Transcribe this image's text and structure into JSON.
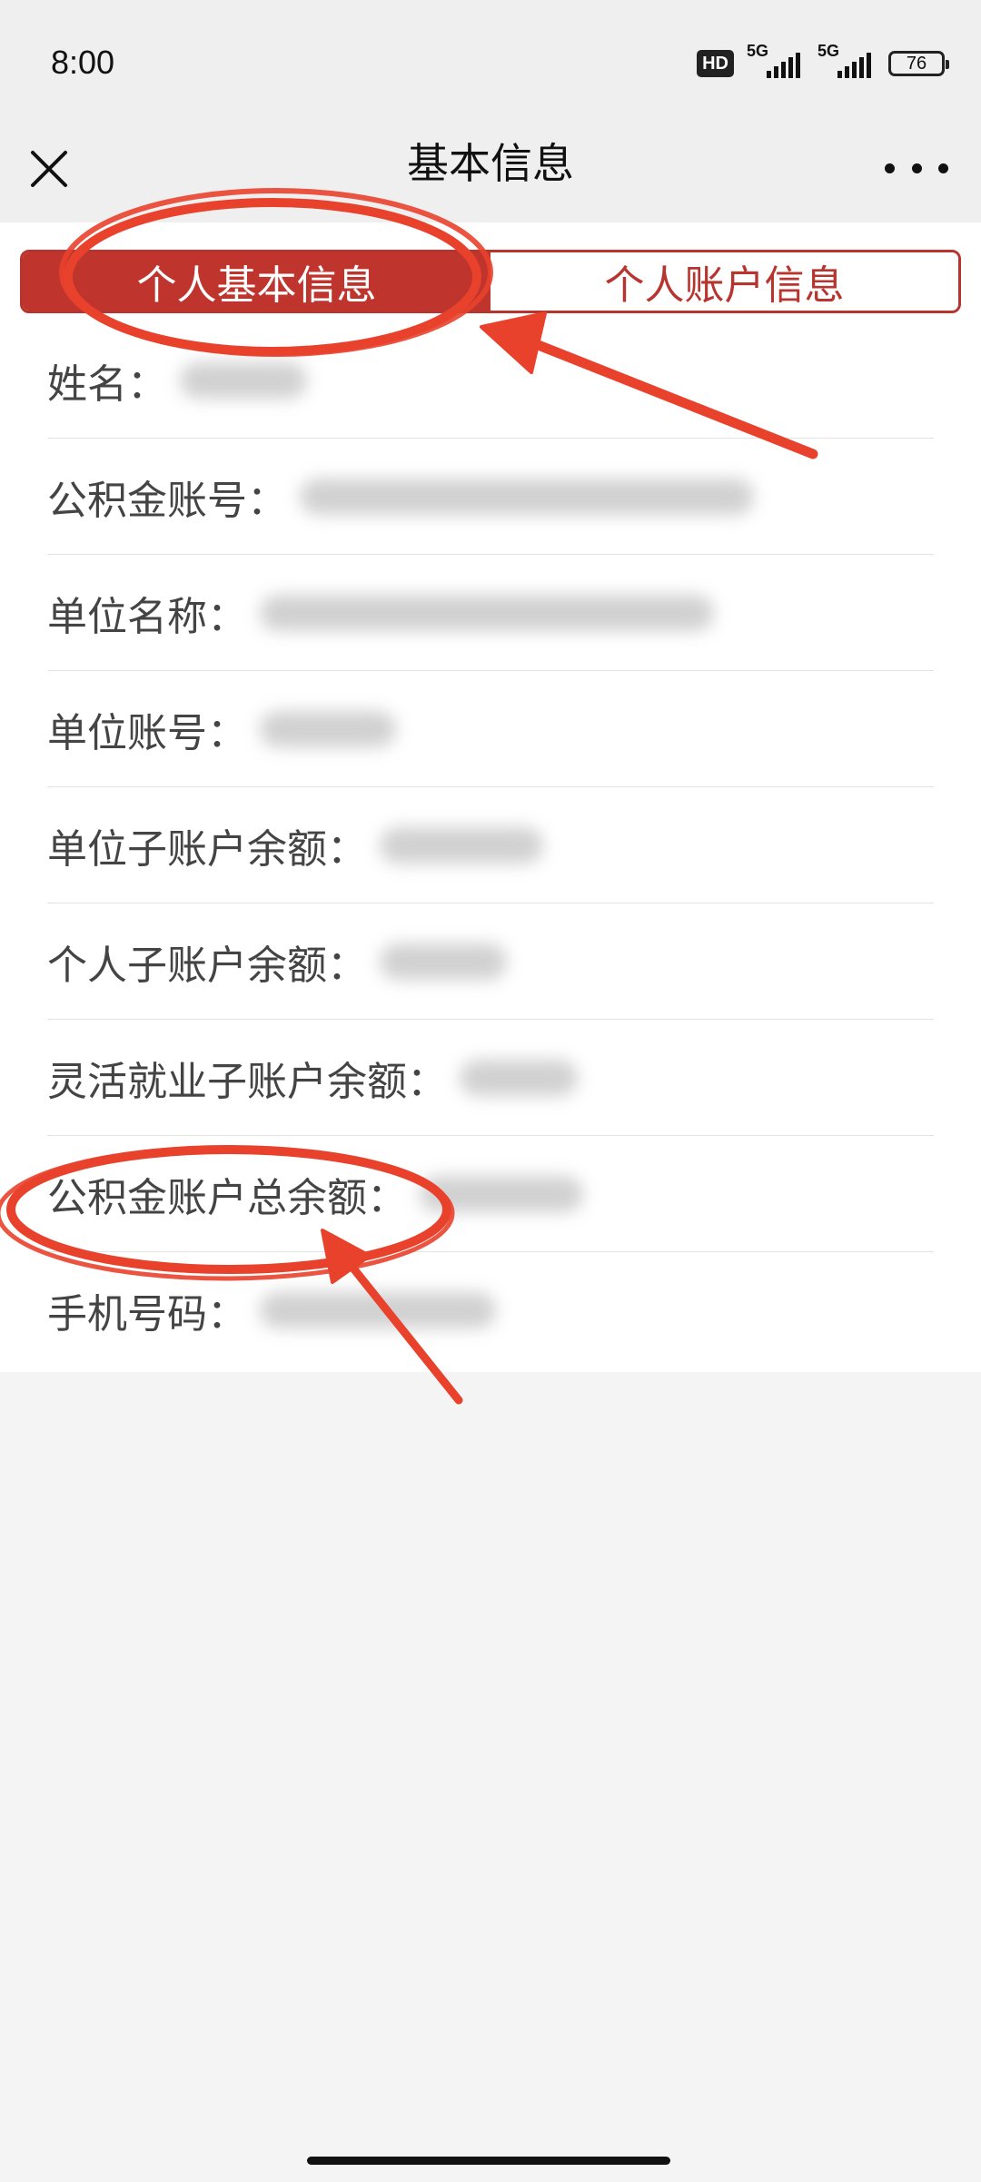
{
  "status_bar": {
    "time": "8:00",
    "hd_badge": "HD",
    "network_1": "5G",
    "network_2": "5G",
    "battery_level": "76"
  },
  "nav": {
    "title": "基本信息",
    "close_icon": "close-icon",
    "more_icon": "more-icon"
  },
  "tabs": [
    {
      "label": "个人基本信息",
      "active": true
    },
    {
      "label": "个人账户信息",
      "active": false
    }
  ],
  "info_rows": [
    {
      "label": "姓名：",
      "value_redacted": true
    },
    {
      "label": "公积金账号：",
      "value_redacted": true
    },
    {
      "label": "单位名称：",
      "value_redacted": true
    },
    {
      "label": "单位账号：",
      "value_redacted": true
    },
    {
      "label": "单位子账户余额：",
      "value_redacted": true
    },
    {
      "label": "个人子账户余额：",
      "value_redacted": true
    },
    {
      "label": "灵活就业子账户余额：",
      "value_redacted": true
    },
    {
      "label": "公积金账户总余额：",
      "value_redacted": true
    },
    {
      "label": "手机号码：",
      "value_redacted": true
    }
  ],
  "colors": {
    "accent": "#c0342e",
    "annotation": "#e8412c",
    "background": "#f4f4f4"
  }
}
